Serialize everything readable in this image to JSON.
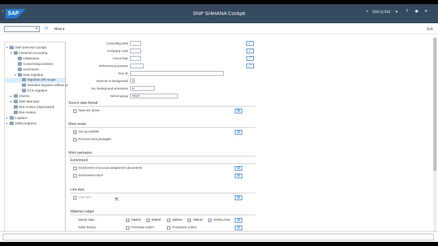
{
  "shell": {
    "logo": "SAP",
    "title": "SNP S/4HANA Cockpit",
    "system_id": "S18 (1) 910"
  },
  "toolbar": {
    "tcode_value": "",
    "more_label": "More",
    "exit_label": "Exit"
  },
  "tree": [
    {
      "label": "SNP S/4HANA Cockpit",
      "level": 0,
      "twisty": "▾"
    },
    {
      "label": "Financial Accounting",
      "level": 1,
      "twisty": "▾"
    },
    {
      "label": "Initialization",
      "level": 2,
      "twisty": ""
    },
    {
      "label": "Customizing activities",
      "level": 2,
      "twisty": ""
    },
    {
      "label": "Enrichment",
      "level": 2,
      "twisty": ""
    },
    {
      "label": "Data migration",
      "level": 2,
      "twisty": "▾"
    },
    {
      "label": "Migration with scope",
      "level": 3,
      "twisty": "",
      "selected": true
    },
    {
      "label": "Standard migration without sc",
      "level": 3,
      "twisty": ""
    },
    {
      "label": "CCS migration",
      "level": 3,
      "twisty": ""
    },
    {
      "label": "Checks",
      "level": 1,
      "twisty": "▸"
    },
    {
      "label": "NZD data load",
      "level": 1,
      "twisty": "▸"
    },
    {
      "label": "Run monitor (deprecated)",
      "level": 1,
      "twisty": ""
    },
    {
      "label": "Run monitor",
      "level": 1,
      "twisty": ""
    },
    {
      "label": "Logistics",
      "level": 0,
      "twisty": "▸"
    },
    {
      "label": "Utility programs",
      "level": 0,
      "twisty": "▸"
    }
  ],
  "fields": {
    "controlling_area": {
      "label": "Controlling area",
      "value": ""
    },
    "company_code": {
      "label": "Company code",
      "value": ""
    },
    "fiscal_year": {
      "label": "Fiscal Year",
      "value": ""
    },
    "reference_processes": {
      "label": "Reference processes",
      "value": ""
    },
    "run_id": {
      "label": "Run ID",
      "value": ""
    },
    "execute_background": {
      "label": "Execute in background",
      "value": "Y"
    },
    "no_background_processes": {
      "label": "No. background processes",
      "value": "5"
    },
    "server_group": {
      "label": "Server group",
      "value": "TEST"
    }
  },
  "sections": {
    "source_data_format": {
      "title": "Source data format",
      "new_gl": "New G/L active"
    },
    "work_mode": {
      "title": "Work mode",
      "set_up_worklist": "Set up worklist",
      "process_work_packages": "Process work packages"
    },
    "work_packages": {
      "title": "Work packages"
    },
    "enrichment": {
      "title": "Enrichment",
      "item1": "Enrichment of account assignment documents",
      "item2": "Enrichment ANLP"
    },
    "line_item": {
      "title": "Line item",
      "item1": "Line item"
    },
    "material_ledger": {
      "title": "Material Ledger",
      "master_data_label": "Master data",
      "order_history_label": "Order history",
      "mbew": "MBEW",
      "ebew": "EBEW",
      "qbew": "QBEW",
      "obew": "OBEW",
      "ckmlhd": "CKMLLAHD",
      "purchase_orders": "Purchase orders",
      "production_orders": "Production orders"
    }
  },
  "icons": {
    "back": "‹",
    "home": "⌂",
    "search": "⌕",
    "user": "◯",
    "history": "◷",
    "select": "⤢"
  },
  "colors": {
    "shell": "#354a5f",
    "accent": "#0a6ed1"
  }
}
